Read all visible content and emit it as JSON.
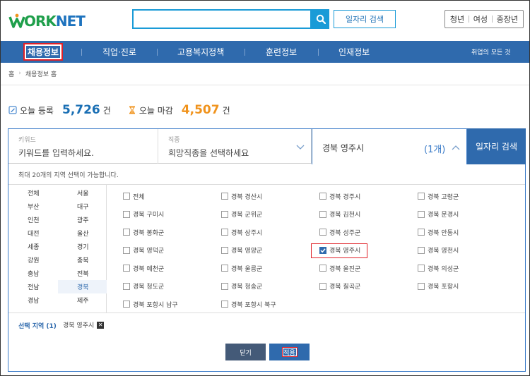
{
  "header": {
    "logo_w": "W",
    "logo_ork": "ORK",
    "logo_net": "NET",
    "search_button_label": "일자리 검색",
    "segments": [
      "청년",
      "여성",
      "중장년"
    ]
  },
  "nav": {
    "items": [
      "채용정보",
      "직업·진로",
      "고용복지정책",
      "훈련정보",
      "인재정보"
    ],
    "all_services": "취업의 모든 것"
  },
  "breadcrumb": {
    "home": "홈",
    "current": "채용정보 홈"
  },
  "counts": {
    "today_label": "오늘 등록",
    "today_value": "5,726",
    "today_unit": "건",
    "close_label": "오늘 마감",
    "close_value": "4,507",
    "close_unit": "건"
  },
  "search": {
    "keyword_label": "키워드",
    "keyword_placeholder": "키워드를 입력하세요.",
    "job_label": "직종",
    "job_placeholder": "희망직종을 선택하세요",
    "region_value": "경북 영주시",
    "region_count": "(1개)",
    "submit_label": "일자리 검색"
  },
  "region_panel": {
    "notice": "최대 20개의 지역 선택이 가능합니다.",
    "provinces": [
      [
        "전체",
        "서울"
      ],
      [
        "부산",
        "대구"
      ],
      [
        "인천",
        "광주"
      ],
      [
        "대전",
        "울산"
      ],
      [
        "세종",
        "경기"
      ],
      [
        "강원",
        "충북"
      ],
      [
        "충남",
        "전북"
      ],
      [
        "전남",
        "경북"
      ],
      [
        "경남",
        "제주"
      ]
    ],
    "selected_province": "경북",
    "cities": [
      [
        "전체",
        "경북 경산시",
        "경북 경주시",
        "경북 고령군"
      ],
      [
        "경북 구미시",
        "경북 군위군",
        "경북 김천시",
        "경북 문경시"
      ],
      [
        "경북 봉화군",
        "경북 상주시",
        "경북 성주군",
        "경북 안동시"
      ],
      [
        "경북 영덕군",
        "경북 영양군",
        "경북 영주시",
        "경북 영천시"
      ],
      [
        "경북 예천군",
        "경북 울릉군",
        "경북 울진군",
        "경북 의성군"
      ],
      [
        "경북 청도군",
        "경북 청송군",
        "경북 칠곡군",
        "경북 포항시"
      ],
      [
        "경북 포항시 남구",
        "경북 포항시 북구"
      ]
    ],
    "checked_city": "경북 영주시",
    "selected_label": "선택 지역 (1)",
    "selected_tag": "경북 영주시",
    "close_label": "닫기",
    "apply_label": "적용"
  }
}
